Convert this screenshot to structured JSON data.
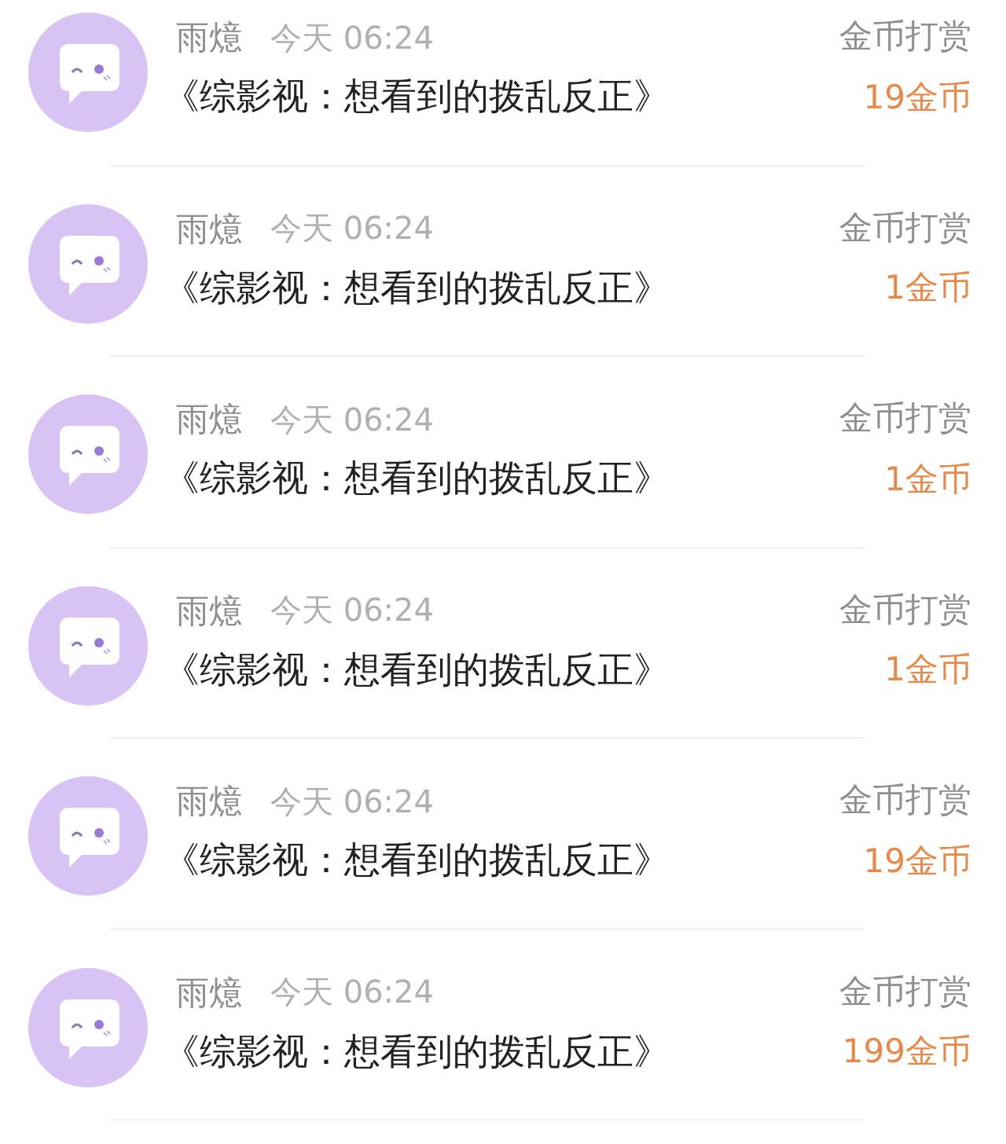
{
  "rows": [
    {
      "user": "雨燱",
      "time": "今天 06:24",
      "action": "金币打赏",
      "work": "《综影视：想看到的拨乱反正》",
      "amount": "19金币"
    },
    {
      "user": "雨燱",
      "time": "今天 06:24",
      "action": "金币打赏",
      "work": "《综影视：想看到的拨乱反正》",
      "amount": "1金币"
    },
    {
      "user": "雨燱",
      "time": "今天 06:24",
      "action": "金币打赏",
      "work": "《综影视：想看到的拨乱反正》",
      "amount": "1金币"
    },
    {
      "user": "雨燱",
      "time": "今天 06:24",
      "action": "金币打赏",
      "work": "《综影视：想看到的拨乱反正》",
      "amount": "1金币"
    },
    {
      "user": "雨燱",
      "time": "今天 06:24",
      "action": "金币打赏",
      "work": "《综影视：想看到的拨乱反正》",
      "amount": "19金币"
    },
    {
      "user": "雨燱",
      "time": "今天 06:24",
      "action": "金币打赏",
      "work": "《综影视：想看到的拨乱反正》",
      "amount": "199金币"
    }
  ]
}
